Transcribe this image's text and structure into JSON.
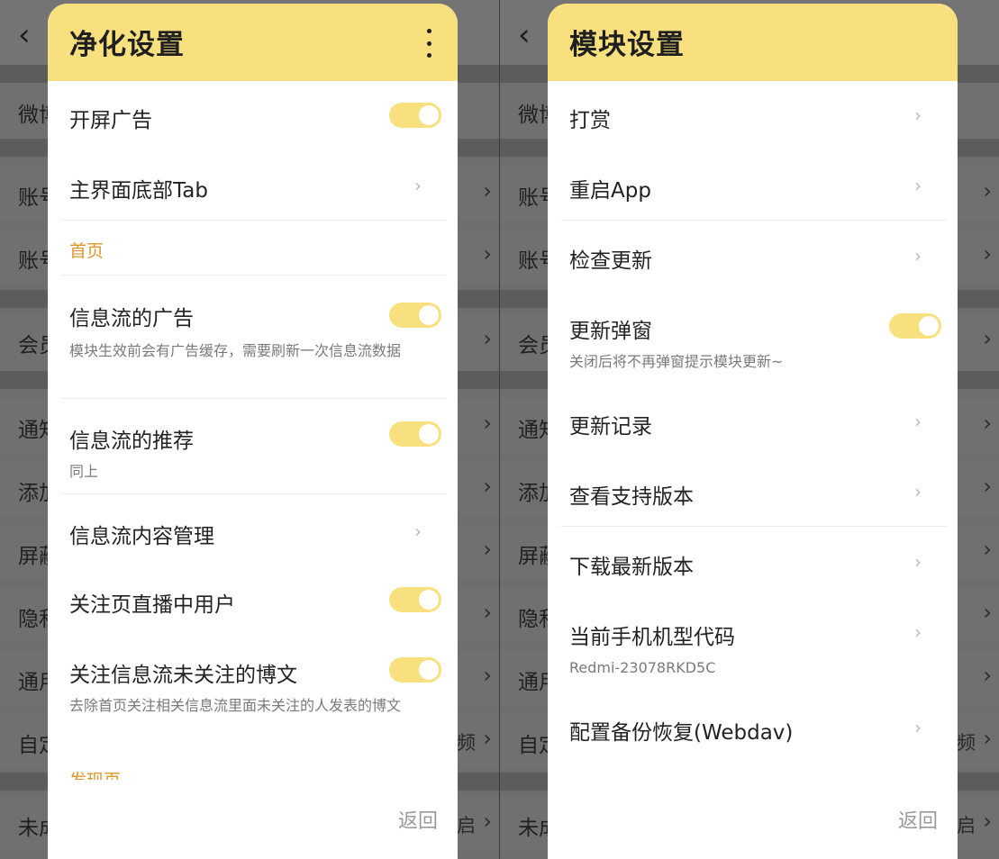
{
  "bg_left": {
    "rows": [
      {
        "text": "微博",
        "rtext": "",
        "chevron": false
      },
      {
        "text": "账号",
        "rtext": "",
        "chevron": true
      },
      {
        "text": "账号",
        "rtext": "",
        "chevron": true
      },
      {
        "text": "会员",
        "rtext": "",
        "chevron": true
      },
      {
        "text": "通知",
        "rtext": "",
        "chevron": true
      },
      {
        "text": "添加",
        "rtext": "",
        "chevron": true
      },
      {
        "text": "屏蔽",
        "rtext": "",
        "chevron": true
      },
      {
        "text": "隐私",
        "rtext": "",
        "chevron": true
      },
      {
        "text": "通用",
        "rtext": "",
        "chevron": true
      },
      {
        "text": "自定",
        "rtext": "频",
        "chevron": true
      },
      {
        "text": "未成",
        "rtext": "启",
        "chevron": true
      }
    ]
  },
  "bg_right": {
    "rows": [
      {
        "text": "微博",
        "rtext": "",
        "chevron": false
      },
      {
        "text": "账号",
        "rtext": "",
        "chevron": true
      },
      {
        "text": "账号",
        "rtext": "",
        "chevron": true
      },
      {
        "text": "会员",
        "rtext": "",
        "chevron": true
      },
      {
        "text": "通知",
        "rtext": "",
        "chevron": true
      },
      {
        "text": "添加",
        "rtext": "",
        "chevron": true
      },
      {
        "text": "屏蔽",
        "rtext": "",
        "chevron": true
      },
      {
        "text": "隐私",
        "rtext": "",
        "chevron": true
      },
      {
        "text": "通用",
        "rtext": "",
        "chevron": true
      },
      {
        "text": "自定",
        "rtext": "频",
        "chevron": true
      },
      {
        "text": "未成",
        "rtext": "启",
        "chevron": true
      }
    ]
  },
  "purify": {
    "title": "净化设置",
    "items": {
      "splash_ad": {
        "label": "开屏广告",
        "toggle": true
      },
      "bottom_tab": {
        "label": "主界面底部Tab"
      },
      "section_home": "首页",
      "feed_ad": {
        "label": "信息流的广告",
        "sub": "模块生效前会有广告缓存，需要刷新一次信息流数据",
        "toggle": true
      },
      "feed_recommend": {
        "label": "信息流的推荐",
        "sub": "同上",
        "toggle": true
      },
      "feed_content": {
        "label": "信息流内容管理"
      },
      "live_users": {
        "label": "关注页直播中用户",
        "toggle": true
      },
      "unfollowed_posts": {
        "label": "关注信息流未关注的博文",
        "sub": "去除首页关注相关信息流里面未关注的人发表的博文",
        "toggle": true
      },
      "section_discover": "发现页"
    },
    "back": "返回"
  },
  "module": {
    "title": "模块设置",
    "items": {
      "reward": {
        "label": "打赏"
      },
      "restart": {
        "label": "重启App"
      },
      "check_update": {
        "label": "检查更新"
      },
      "update_popup": {
        "label": "更新弹窗",
        "sub": "关闭后将不再弹窗提示模块更新~",
        "toggle": true
      },
      "changelog": {
        "label": "更新记录"
      },
      "supported": {
        "label": "查看支持版本"
      },
      "download": {
        "label": "下载最新版本"
      },
      "device_code": {
        "label": "当前手机机型代码",
        "sub": "Redmi-23078RKD5C"
      },
      "backup": {
        "label": "配置备份恢复(Webdav)"
      }
    },
    "back": "返回"
  }
}
